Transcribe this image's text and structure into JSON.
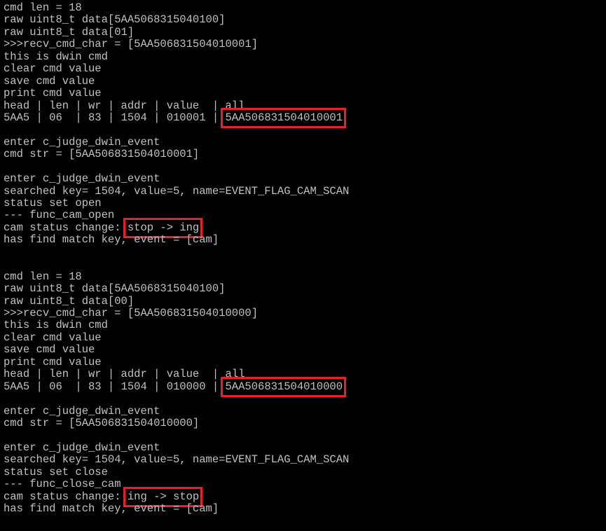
{
  "terminal": {
    "text_color": "#c0c0c0",
    "background": "#000000",
    "highlight_color": "#e8202a",
    "lines": [
      {
        "pre": "cmd len = 18"
      },
      {
        "pre": "raw uint8_t data[5AA5068315040100]"
      },
      {
        "pre": "raw uint8_t data[01]"
      },
      {
        "pre": ">>>recv_cmd_char = [5AA506831504010001]"
      },
      {
        "pre": "this is dwin cmd"
      },
      {
        "pre": "clear cmd value"
      },
      {
        "pre": "save cmd value"
      },
      {
        "pre": "print cmd value"
      },
      {
        "pre": "head | len | wr | addr | value  | all"
      },
      {
        "pre": "5AA5 | 06  | 83 | 1504 | 010001 | ",
        "hl": "5AA506831504010001"
      },
      {
        "pre": ""
      },
      {
        "pre": "enter c_judge_dwin_event"
      },
      {
        "pre": "cmd str = [5AA506831504010001]"
      },
      {
        "pre": ""
      },
      {
        "pre": "enter c_judge_dwin_event"
      },
      {
        "pre": "searched key= 1504, value=5, name=EVENT_FLAG_CAM_SCAN"
      },
      {
        "pre": "status set open"
      },
      {
        "pre": "--- func_cam_open"
      },
      {
        "pre": "cam status change: ",
        "hl": "stop -> ing"
      },
      {
        "pre": "has find match key, event = [cam]"
      },
      {
        "pre": ""
      },
      {
        "pre": ""
      },
      {
        "pre": "cmd len = 18"
      },
      {
        "pre": "raw uint8_t data[5AA5068315040100]"
      },
      {
        "pre": "raw uint8_t data[00]"
      },
      {
        "pre": ">>>recv_cmd_char = [5AA506831504010000]"
      },
      {
        "pre": "this is dwin cmd"
      },
      {
        "pre": "clear cmd value"
      },
      {
        "pre": "save cmd value"
      },
      {
        "pre": "print cmd value"
      },
      {
        "pre": "head | len | wr | addr | value  | all"
      },
      {
        "pre": "5AA5 | 06  | 83 | 1504 | 010000 | ",
        "hl": "5AA506831504010000"
      },
      {
        "pre": ""
      },
      {
        "pre": "enter c_judge_dwin_event"
      },
      {
        "pre": "cmd str = [5AA506831504010000]"
      },
      {
        "pre": ""
      },
      {
        "pre": "enter c_judge_dwin_event"
      },
      {
        "pre": "searched key= 1504, value=5, name=EVENT_FLAG_CAM_SCAN"
      },
      {
        "pre": "status set close"
      },
      {
        "pre": "--- func_close_cam"
      },
      {
        "pre": "cam status change: ",
        "hl": "ing -> stop"
      },
      {
        "pre": "has find match key, event = [cam]"
      }
    ]
  }
}
